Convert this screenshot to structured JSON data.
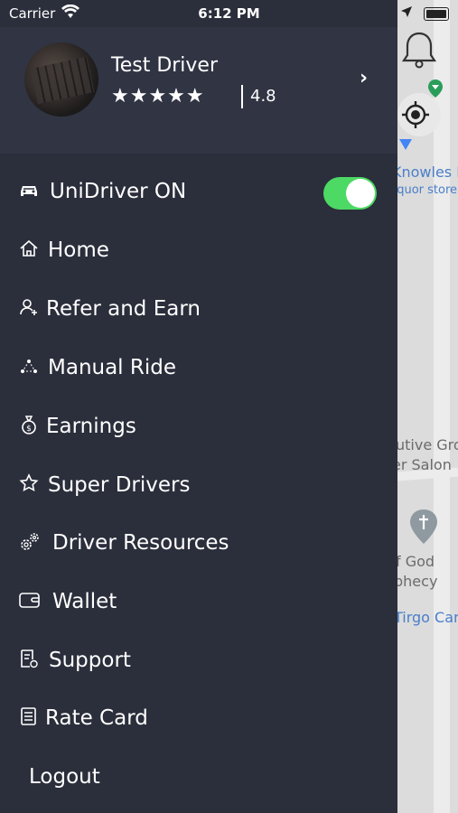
{
  "status_bar": {
    "carrier": "Carrier",
    "time": "6:12 PM"
  },
  "profile": {
    "name": "Test Driver",
    "stars": "★★★★★",
    "rating": "4.8"
  },
  "menu": {
    "unidriver_label": "UniDriver ON",
    "unidriver_on": true,
    "home": "Home",
    "refer": "Refer and Earn",
    "manual_ride": "Manual Ride",
    "earnings": "Earnings",
    "super_drivers": "Super Drivers",
    "driver_resources": "Driver Resources",
    "wallet": "Wallet",
    "support": "Support",
    "rate_card": "Rate Card",
    "logout": "Logout"
  },
  "map": {
    "labels": [
      "Knowles L",
      "liquor store",
      "utive Gro",
      "er Salon",
      "f God",
      "phecy",
      "Tirgo Car"
    ]
  },
  "colors": {
    "drawer": "#2b2e3b",
    "header": "#303443",
    "toggle_on": "#4cd964"
  }
}
